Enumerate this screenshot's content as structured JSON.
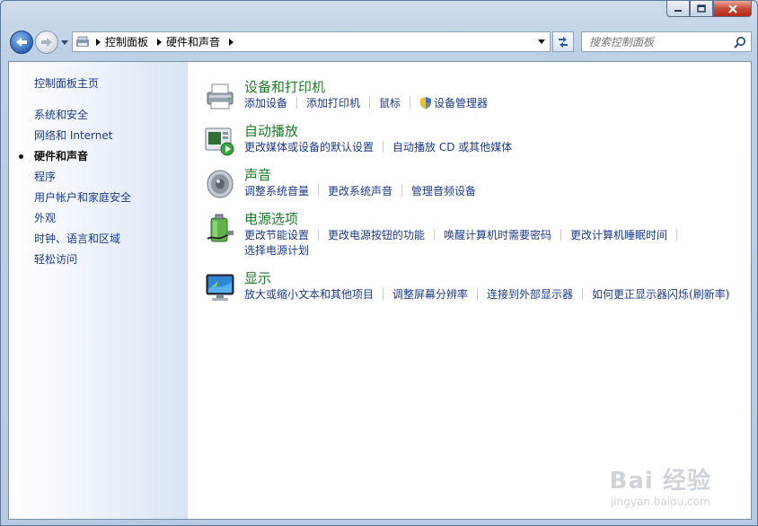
{
  "address": {
    "crumbs": [
      "控制面板",
      "硬件和声音"
    ]
  },
  "search": {
    "placeholder": "搜索控制面板"
  },
  "sidebar": {
    "home": "控制面板主页",
    "items": [
      {
        "label": "系统和安全"
      },
      {
        "label": "网络和 Internet"
      },
      {
        "label": "硬件和声音",
        "current": true
      },
      {
        "label": "程序"
      },
      {
        "label": "用户帐户和家庭安全"
      },
      {
        "label": "外观"
      },
      {
        "label": "时钟、语言和区域"
      },
      {
        "label": "轻松访问"
      }
    ]
  },
  "categories": [
    {
      "title": "设备和打印机",
      "icon": "printer-icon",
      "links": [
        "添加设备",
        "添加打印机",
        "鼠标",
        "设备管理器"
      ]
    },
    {
      "title": "自动播放",
      "icon": "autoplay-icon",
      "links": [
        "更改媒体或设备的默认设置",
        "自动播放 CD 或其他媒体"
      ]
    },
    {
      "title": "声音",
      "icon": "speaker-icon",
      "links": [
        "调整系统音量",
        "更改系统声音",
        "管理音频设备"
      ]
    },
    {
      "title": "电源选项",
      "icon": "battery-icon",
      "links": [
        "更改节能设置",
        "更改电源按钮的功能",
        "唤醒计算机时需要密码",
        "更改计算机睡眠时间",
        "选择电源计划"
      ]
    },
    {
      "title": "显示",
      "icon": "monitor-icon",
      "links": [
        "放大或缩小文本和其他项目",
        "调整屏幕分辨率",
        "连接到外部显示器",
        "如何更正显示器闪烁(刷新率)"
      ]
    }
  ],
  "watermark": {
    "line1": "Bai 经验",
    "line2": "jingyan.baidu.com"
  }
}
